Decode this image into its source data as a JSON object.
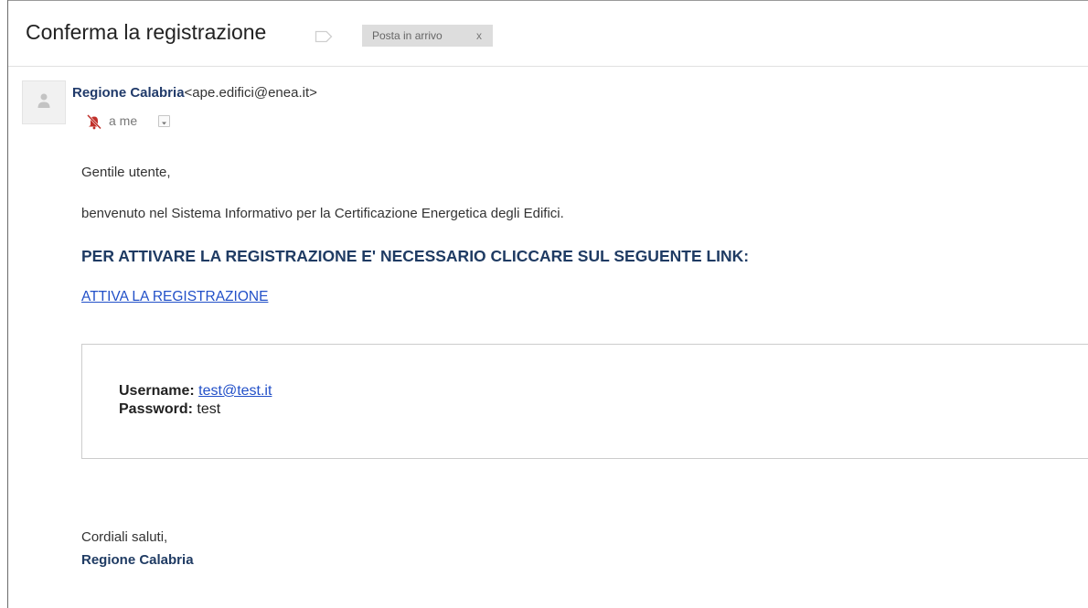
{
  "email": {
    "subject": "Conferma la registrazione",
    "label_chip": "Posta in arrivo",
    "label_chip_close": "x",
    "sender_name": "Regione Calabria",
    "sender_email": "<ape.edifici@enea.it>",
    "recipient": "a me",
    "icons": {
      "label": "label-tag-icon",
      "avatar": "person-icon",
      "mute": "mute-bell-icon",
      "details": "dropdown-arrow-icon"
    },
    "colors": {
      "sender": "#203a6a",
      "link": "#2250c8",
      "mute_icon": "#c0302a",
      "chip_bg": "#dddddd"
    }
  },
  "body": {
    "greeting": "Gentile utente,",
    "welcome": "benvenuto nel Sistema Informativo per la Certificazione Energetica degli Edifici.",
    "notice": "PER ATTIVARE LA REGISTRAZIONE E' NECESSARIO CLICCARE SUL SEGUENTE LINK:",
    "activate_link": "ATTIVA LA REGISTRAZIONE",
    "credentials": {
      "username_label": "Username:",
      "username_value": "test@test.it",
      "password_label": "Password:",
      "password_value": "test"
    },
    "closing": "Cordiali saluti,",
    "signature": "Regione Calabria"
  }
}
